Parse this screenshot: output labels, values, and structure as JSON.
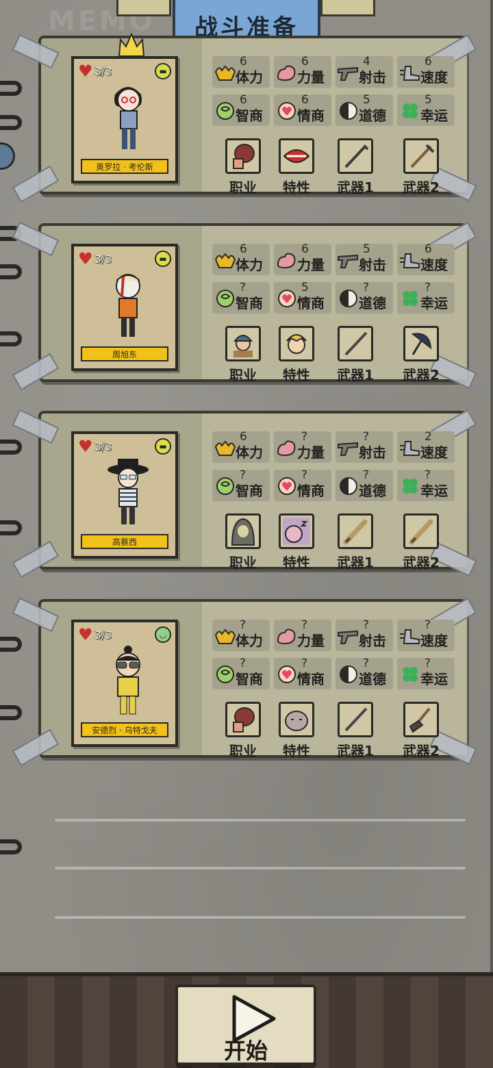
{
  "header": {
    "title": "战斗准备",
    "memo": "MEMO"
  },
  "stat_labels": {
    "stamina": "体力",
    "strength": "力量",
    "shooting": "射击",
    "speed": "速度",
    "intelligence": "智商",
    "eq": "情商",
    "morality": "道德",
    "luck": "幸运"
  },
  "slot_labels": {
    "job": "职业",
    "trait": "特性",
    "weapon1": "武器1",
    "weapon2": "武器2"
  },
  "characters": [
    {
      "name": "奥罗拉 · 考伦斯",
      "hp": "3/3",
      "mood": "grin",
      "crowned": true,
      "stats": {
        "stamina": "6",
        "strength": "6",
        "shooting": "4",
        "speed": "6",
        "intelligence": "6",
        "eq": "6",
        "morality": "5",
        "luck": "5"
      },
      "icons": {
        "job": "boxing-glove-icon",
        "trait": "lips-icon",
        "weapon1": "crowbar-icon",
        "weapon2": "crutch-icon"
      }
    },
    {
      "name": "周旭东",
      "hp": "3/3",
      "mood": "grin",
      "crowned": false,
      "stats": {
        "stamina": "6",
        "strength": "6",
        "shooting": "5",
        "speed": "6",
        "intelligence": "?",
        "eq": "5",
        "morality": "?",
        "luck": "?"
      },
      "icons": {
        "job": "soldier-icon",
        "trait": "blonde-face-icon",
        "weapon1": "stick-icon",
        "weapon2": "umbrella-icon"
      }
    },
    {
      "name": "高蔡西",
      "hp": "3/3",
      "mood": "grin",
      "crowned": false,
      "stats": {
        "stamina": "6",
        "strength": "?",
        "shooting": "?",
        "speed": "2",
        "intelligence": "?",
        "eq": "?",
        "morality": "?",
        "luck": "?"
      },
      "icons": {
        "job": "hooded-figure-icon",
        "trait": "sleeping-face-icon",
        "weapon1": "bat-icon",
        "weapon2": "bat-icon"
      }
    },
    {
      "name": "安德烈 · 乌特戈夫",
      "hp": "3/3",
      "mood": "smile",
      "crowned": false,
      "stats": {
        "stamina": "?",
        "strength": "?",
        "shooting": "?",
        "speed": "?",
        "intelligence": "?",
        "eq": "?",
        "morality": "?",
        "luck": "?"
      },
      "icons": {
        "job": "boxing-glove-icon",
        "trait": "fat-face-icon",
        "weapon1": "stick-icon",
        "weapon2": "shovel-icon"
      }
    }
  ],
  "start_button": {
    "label": "开始"
  },
  "colors": {
    "title_tab": "#7aa6d6",
    "name_plate": "#f2c21a",
    "heart": "#c8302a",
    "mood_grin": "#d7e04a",
    "mood_smile": "#8fd08a"
  }
}
